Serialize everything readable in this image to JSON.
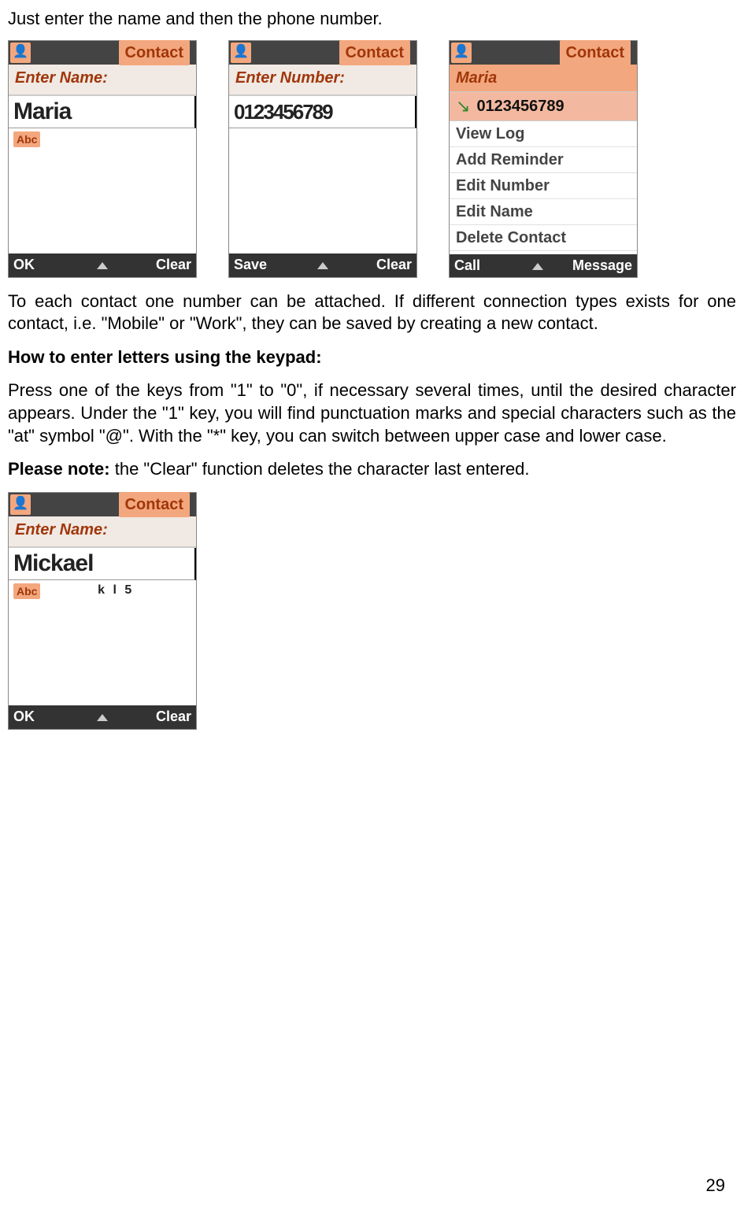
{
  "intro": "Just enter the name and then the phone number.",
  "screen1": {
    "title": "Contact",
    "label": "Enter Name:",
    "value": "Maria",
    "abc": "Abc",
    "sk_left": "OK",
    "sk_right": "Clear"
  },
  "screen2": {
    "title": "Contact",
    "label": "Enter Number:",
    "value": "0123456789",
    "sk_left": "Save",
    "sk_right": "Clear"
  },
  "screen3": {
    "title": "Contact",
    "header": "Maria",
    "number": "0123456789",
    "items": [
      "View Log",
      "Add Reminder",
      "Edit Number",
      "Edit Name",
      "Delete Contact"
    ],
    "sk_left": "Call",
    "sk_right": "Message"
  },
  "para_attach": "To each contact one number can be attached. If different connection types exists for one contact, i.e. \"Mobile\" or \"Work\", they can be saved by creating a new contact.",
  "heading_keypad": "How to enter letters using the keypad:",
  "para_keypad": "Press one of the keys from \"1\" to \"0\", if necessary several times, until the desired character appears. Under the \"1\" key, you will find punctuation marks and special characters such as the \"at\" symbol \"@\". With the \"*\" key, you can switch between upper case and lower case.",
  "note_label": "Please note:",
  "note_text": " the \"Clear\" function deletes the character last entered.",
  "screen4": {
    "title": "Contact",
    "label": "Enter Name:",
    "value": "Mickael",
    "abc": "Abc",
    "hint": "k l 5",
    "sk_left": "OK",
    "sk_right": "Clear"
  },
  "page_number": "29"
}
